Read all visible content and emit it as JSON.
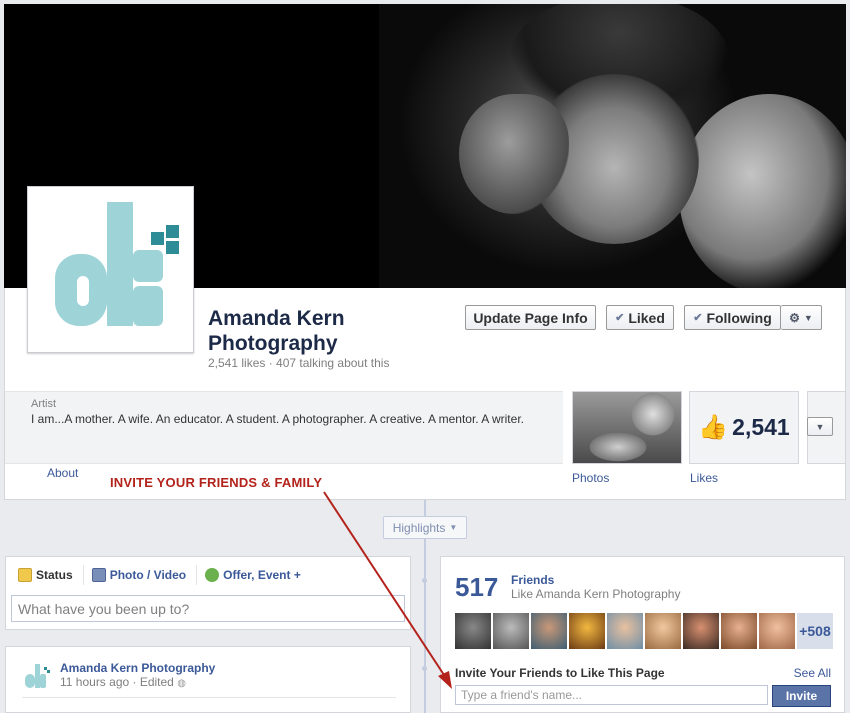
{
  "page": {
    "name": "Amanda Kern Photography",
    "stats": "2,541 likes · 407 talking about this"
  },
  "buttons": {
    "update_page_info": "Update Page Info",
    "liked": "Liked",
    "following": "Following"
  },
  "about": {
    "category": "Artist",
    "text": "I am...A mother. A wife. An educator. A student. A photographer. A creative. A mentor. A writer.",
    "link": "About"
  },
  "apps": {
    "photos_label": "Photos",
    "likes_label": "Likes",
    "likes_count": "2,541"
  },
  "annotation": {
    "invite_text": "INVITE YOUR FRIENDS & FAMILY",
    "color": "#b3231c"
  },
  "timeline": {
    "highlights_label": "Highlights"
  },
  "composer": {
    "tabs": [
      "Status",
      "Photo / Video",
      "Offer, Event +"
    ],
    "placeholder": "What have you been up to?"
  },
  "post": {
    "author": "Amanda Kern Photography",
    "meta": "11 hours ago · Edited"
  },
  "friends": {
    "count": "517",
    "title": "Friends",
    "subtitle": "Like Amanda Kern Photography",
    "more_count": "+508",
    "invite_title": "Invite Your Friends to Like This Page",
    "see_all": "See All",
    "invite_placeholder": "Type a friend's name...",
    "invite_button": "Invite"
  },
  "colors": {
    "brand_blue": "#3b5998",
    "logo_teal": "#9ed4d7",
    "logo_dark_teal": "#2e8c96"
  },
  "icons": [
    "gear-icon",
    "check-icon",
    "thumbs-up-icon",
    "chevron-down-icon",
    "status-icon",
    "photo-icon",
    "offer-icon",
    "globe-icon"
  ]
}
